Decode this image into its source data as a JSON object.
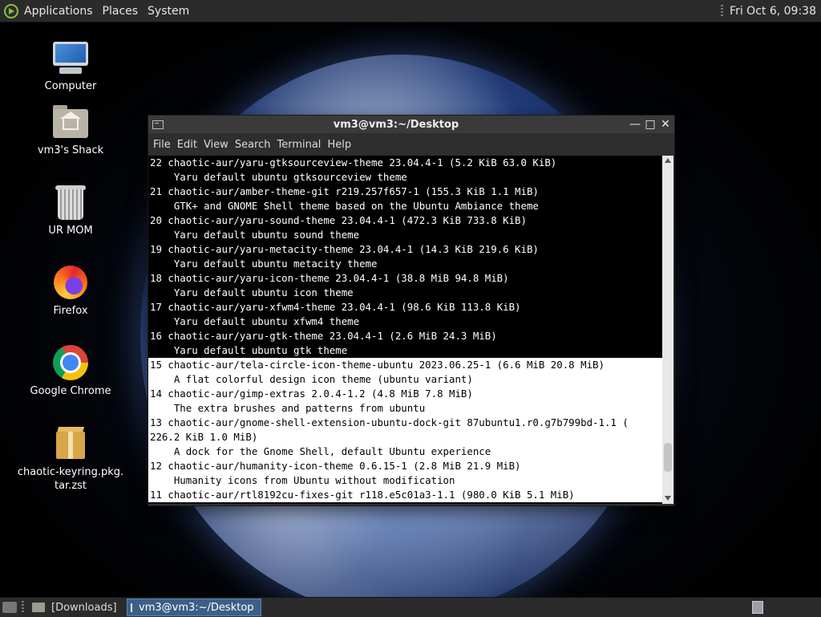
{
  "top_panel": {
    "menus": [
      "Applications",
      "Places",
      "System"
    ],
    "clock": "Fri Oct  6, 09:38"
  },
  "desktop_icons": [
    {
      "label": "Computer",
      "icon": "computer-icon"
    },
    {
      "label": "vm3's Shack",
      "icon": "home-folder-icon"
    },
    {
      "label": "UR MOM",
      "icon": "trash-icon"
    },
    {
      "label": "Firefox",
      "icon": "firefox-icon"
    },
    {
      "label": "Google Chrome",
      "icon": "chrome-icon"
    },
    {
      "label": "chaotic-keyring.pkg.\ntar.zst",
      "icon": "package-icon"
    }
  ],
  "terminal": {
    "title": "vm3@vm3:~/Desktop",
    "menus": [
      "File",
      "Edit",
      "View",
      "Search",
      "Terminal",
      "Help"
    ],
    "lines": [
      {
        "text": "22 chaotic-aur/yaru-gtksourceview-theme 23.04.4-1 (5.2 KiB 63.0 KiB)",
        "style": "dark"
      },
      {
        "text": "    Yaru default ubuntu gtksourceview theme",
        "style": "dark"
      },
      {
        "text": "21 chaotic-aur/amber-theme-git r219.257f657-1 (155.3 KiB 1.1 MiB)",
        "style": "dark"
      },
      {
        "text": "    GTK+ and GNOME Shell theme based on the Ubuntu Ambiance theme",
        "style": "dark"
      },
      {
        "text": "20 chaotic-aur/yaru-sound-theme 23.04.4-1 (472.3 KiB 733.8 KiB)",
        "style": "dark"
      },
      {
        "text": "    Yaru default ubuntu sound theme",
        "style": "dark"
      },
      {
        "text": "19 chaotic-aur/yaru-metacity-theme 23.04.4-1 (14.3 KiB 219.6 KiB)",
        "style": "dark"
      },
      {
        "text": "    Yaru default ubuntu metacity theme",
        "style": "dark"
      },
      {
        "text": "18 chaotic-aur/yaru-icon-theme 23.04.4-1 (38.8 MiB 94.8 MiB)",
        "style": "dark"
      },
      {
        "text": "    Yaru default ubuntu icon theme",
        "style": "dark"
      },
      {
        "text": "17 chaotic-aur/yaru-xfwm4-theme 23.04.4-1 (98.6 KiB 113.8 KiB)",
        "style": "dark"
      },
      {
        "text": "    Yaru default ubuntu xfwm4 theme",
        "style": "dark"
      },
      {
        "text": "16 chaotic-aur/yaru-gtk-theme 23.04.4-1 (2.6 MiB 24.3 MiB)",
        "style": "dark"
      },
      {
        "text": "    Yaru default ubuntu gtk theme",
        "style": "dark"
      },
      {
        "text": "15 chaotic-aur/tela-circle-icon-theme-ubuntu 2023.06.25-1 (6.6 MiB 20.8 MiB)",
        "style": "light"
      },
      {
        "text": "    A flat colorful design icon theme (ubuntu variant)",
        "style": "light"
      },
      {
        "text": "14 chaotic-aur/gimp-extras 2.0.4-1.2 (4.8 MiB 7.8 MiB)",
        "style": "light"
      },
      {
        "text": "    The extra brushes and patterns from ubuntu",
        "style": "light"
      },
      {
        "text": "13 chaotic-aur/gnome-shell-extension-ubuntu-dock-git 87ubuntu1.r0.g7b799bd-1.1 (",
        "style": "light"
      },
      {
        "text": "226.2 KiB 1.0 MiB)",
        "style": "light"
      },
      {
        "text": "    A dock for the Gnome Shell, default Ubuntu experience",
        "style": "light"
      },
      {
        "text": "12 chaotic-aur/humanity-icon-theme 0.6.15-1 (2.8 MiB 21.9 MiB)",
        "style": "light"
      },
      {
        "text": "    Humanity icons from Ubuntu without modification",
        "style": "light"
      },
      {
        "text": "11 chaotic-aur/rtl8192cu-fixes-git r118.e5c01a3-1.1 (980.0 KiB 5.1 MiB)",
        "style": "light"
      }
    ]
  },
  "bottom_panel": {
    "tasks": [
      {
        "label": "[Downloads]",
        "icon": "folder-icon",
        "active": false
      },
      {
        "label": "vm3@vm3:~/Desktop",
        "icon": "terminal-icon",
        "active": true
      }
    ]
  },
  "colors": {
    "panel": "#2b2b2b",
    "active_task": "#3b5f86",
    "terminal_bg": "#000000",
    "highlight_bg": "#ffffff"
  }
}
